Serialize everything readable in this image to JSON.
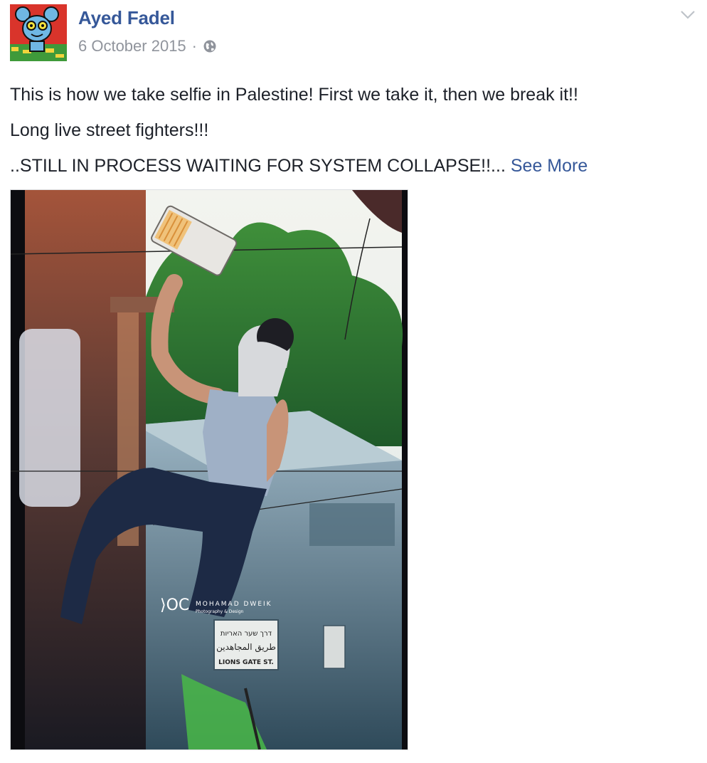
{
  "post": {
    "author": "Ayed Fadel",
    "date": "6 October 2015",
    "separator": "·",
    "privacy_icon": "globe-icon",
    "menu_icon": "chevron-down-icon",
    "lines": [
      "This is how we take selfie in Palestine! First we take it, then we break it!!",
      "Long live street fighters!!!",
      "..STILL IN PROCESS WAITING FOR SYSTEM COLLAPSE!!..."
    ],
    "see_more": "See More"
  },
  "photo": {
    "watermark": "MOHAMAD DWEIK",
    "watermark_sub": "Photography & Design",
    "sign_hebrew": "דרך שער האריות",
    "sign_arabic": "طريق المجاهدين",
    "sign_english": "LIONS GATE ST."
  },
  "colors": {
    "link": "#365899",
    "meta": "#90949c",
    "text": "#1d2129"
  }
}
